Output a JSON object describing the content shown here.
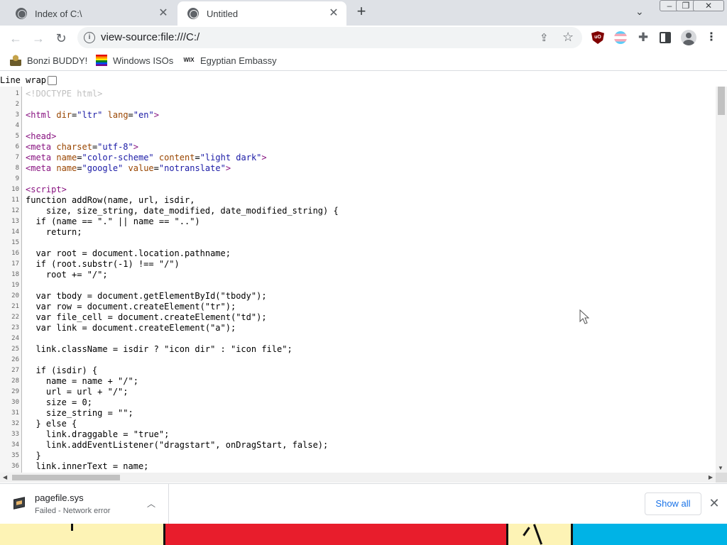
{
  "tabs": [
    {
      "title": "Index of C:\\",
      "active": false
    },
    {
      "title": "Untitled",
      "active": true
    }
  ],
  "toolbar": {
    "url": "view-source:file:///C:/"
  },
  "bookmarks": [
    {
      "label": "Bonzi BUDDY!",
      "icon": "bonzi-icon"
    },
    {
      "label": "Windows ISOs",
      "icon": "rainbow-flag-icon"
    },
    {
      "label": "Egyptian Embassy",
      "icon": "wix-icon",
      "icon_text": "WIX"
    }
  ],
  "source_view": {
    "line_wrap_label": "Line wrap",
    "line_wrap_checked": false,
    "lines": [
      {
        "n": "1",
        "text": "<!DOCTYPE html>"
      },
      {
        "n": "2",
        "text": ""
      },
      {
        "n": "3",
        "text": "<html dir=\"ltr\" lang=\"en\">"
      },
      {
        "n": "4",
        "text": ""
      },
      {
        "n": "5",
        "text": "<head>"
      },
      {
        "n": "6",
        "text": "<meta charset=\"utf-8\">"
      },
      {
        "n": "7",
        "text": "<meta name=\"color-scheme\" content=\"light dark\">"
      },
      {
        "n": "8",
        "text": "<meta name=\"google\" value=\"notranslate\">"
      },
      {
        "n": "9",
        "text": ""
      },
      {
        "n": "10",
        "text": "<script>"
      },
      {
        "n": "11",
        "text": "function addRow(name, url, isdir,"
      },
      {
        "n": "12",
        "text": "    size, size_string, date_modified, date_modified_string) {"
      },
      {
        "n": "13",
        "text": "  if (name == \".\" || name == \"..\")"
      },
      {
        "n": "14",
        "text": "    return;"
      },
      {
        "n": "15",
        "text": ""
      },
      {
        "n": "16",
        "text": "  var root = document.location.pathname;"
      },
      {
        "n": "17",
        "text": "  if (root.substr(-1) !== \"/\")"
      },
      {
        "n": "18",
        "text": "    root += \"/\";"
      },
      {
        "n": "19",
        "text": ""
      },
      {
        "n": "20",
        "text": "  var tbody = document.getElementById(\"tbody\");"
      },
      {
        "n": "21",
        "text": "  var row = document.createElement(\"tr\");"
      },
      {
        "n": "22",
        "text": "  var file_cell = document.createElement(\"td\");"
      },
      {
        "n": "23",
        "text": "  var link = document.createElement(\"a\");"
      },
      {
        "n": "24",
        "text": ""
      },
      {
        "n": "25",
        "text": "  link.className = isdir ? \"icon dir\" : \"icon file\";"
      },
      {
        "n": "26",
        "text": ""
      },
      {
        "n": "27",
        "text": "  if (isdir) {"
      },
      {
        "n": "28",
        "text": "    name = name + \"/\";"
      },
      {
        "n": "29",
        "text": "    url = url + \"/\";"
      },
      {
        "n": "30",
        "text": "    size = 0;"
      },
      {
        "n": "31",
        "text": "    size_string = \"\";"
      },
      {
        "n": "32",
        "text": "  } else {"
      },
      {
        "n": "33",
        "text": "    link.draggable = \"true\";"
      },
      {
        "n": "34",
        "text": "    link.addEventListener(\"dragstart\", onDragStart, false);"
      },
      {
        "n": "35",
        "text": "  }"
      },
      {
        "n": "36",
        "text": "  link.innerText = name;"
      }
    ]
  },
  "download": {
    "filename": "pagefile.sys",
    "status": "Failed - Network error",
    "show_all_label": "Show all"
  },
  "colors": {
    "tabstrip": "#dee1e6",
    "accent": "#1a73e8",
    "tag": "#881280",
    "attr": "#994500",
    "value": "#1a1aa6"
  }
}
